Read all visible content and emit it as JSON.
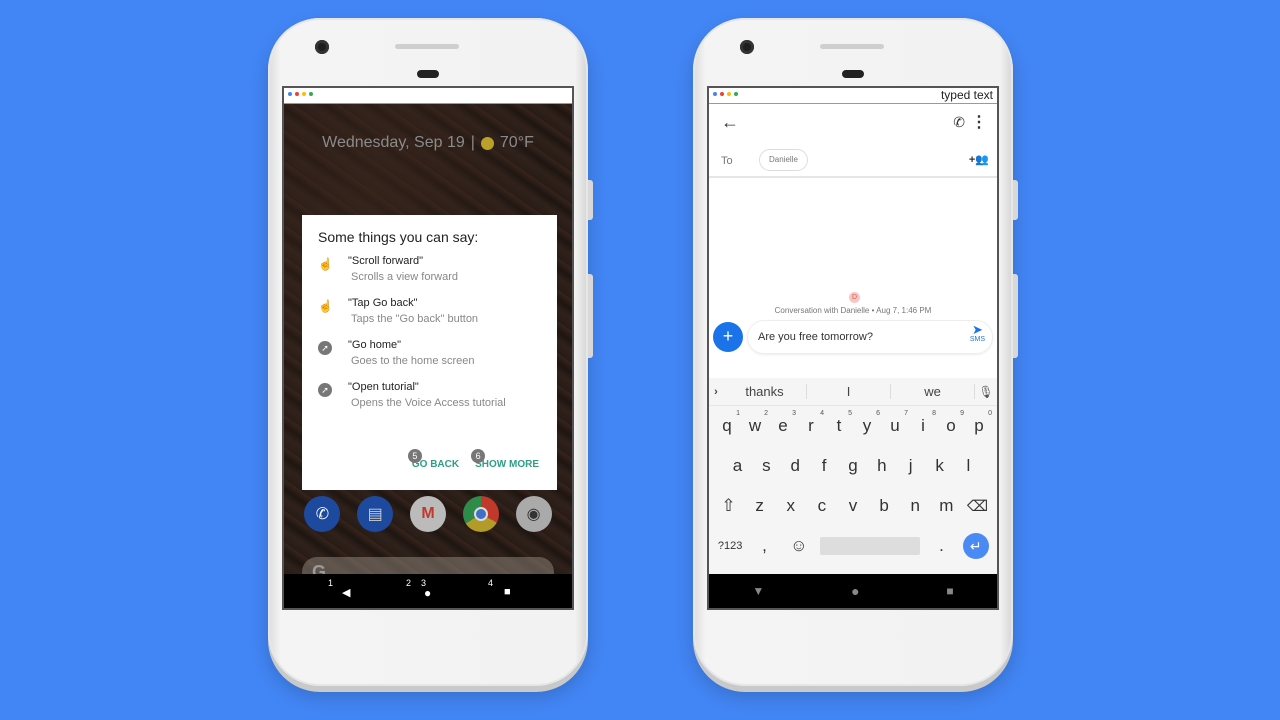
{
  "colors": {
    "background": "#4285f4",
    "accent_blue": "#1a73e8",
    "dialog_button_green": "#2e9e86",
    "status_dots": [
      "#4285f4",
      "#ea4335",
      "#fbbc05",
      "#34a853"
    ]
  },
  "left_phone": {
    "lock_info": {
      "date": "Wednesday, Sep 19",
      "separator": "|",
      "weather_icon": "sun-cloud-icon",
      "temperature": "70°F"
    },
    "voice_access_dialog": {
      "title": "Some things you can say:",
      "commands": [
        {
          "icon": "touch-icon",
          "name": "\"Scroll  forward\"",
          "description": "Scrolls a view forward"
        },
        {
          "icon": "touch-icon",
          "name": "\"Tap Go back\"",
          "description": "Taps the \"Go back\" button"
        },
        {
          "icon": "compass-icon",
          "name": "\"Go home\"",
          "description": "Goes to the home screen"
        },
        {
          "icon": "compass-icon",
          "name": "\"Open tutorial\"",
          "description": "Opens the Voice Access tutorial"
        }
      ],
      "actions": [
        {
          "label": "GO BACK",
          "number": "5"
        },
        {
          "label": "SHOW MORE",
          "number": "6"
        }
      ]
    },
    "dock_apps": [
      "phone",
      "messages",
      "gmail",
      "chrome",
      "camera"
    ],
    "search_bar_logo": "G",
    "nav_numbers": {
      "back": "1",
      "home_a": "2",
      "home_b": "3",
      "recents": "4"
    }
  },
  "right_phone": {
    "status_text": "typed text",
    "to_label": "To",
    "recipient": "Danielle",
    "avatar_letter": "D",
    "conversation_info": "Conversation with Danielle • Aug 7, 1:46 PM",
    "compose_text": "Are you free tomorrow?",
    "send_label": "SMS",
    "suggestions": [
      "thanks",
      "I",
      "we"
    ],
    "keyboard": {
      "row1": [
        {
          "k": "q",
          "n": "1"
        },
        {
          "k": "w",
          "n": "2"
        },
        {
          "k": "e",
          "n": "3"
        },
        {
          "k": "r",
          "n": "4"
        },
        {
          "k": "t",
          "n": "5"
        },
        {
          "k": "y",
          "n": "6"
        },
        {
          "k": "u",
          "n": "7"
        },
        {
          "k": "i",
          "n": "8"
        },
        {
          "k": "o",
          "n": "9"
        },
        {
          "k": "p",
          "n": "0"
        }
      ],
      "row2": [
        "a",
        "s",
        "d",
        "f",
        "g",
        "h",
        "j",
        "k",
        "l"
      ],
      "row3": [
        "z",
        "x",
        "c",
        "v",
        "b",
        "n",
        "m"
      ],
      "symbols_label": "?123",
      "comma": ",",
      "period": "."
    }
  }
}
